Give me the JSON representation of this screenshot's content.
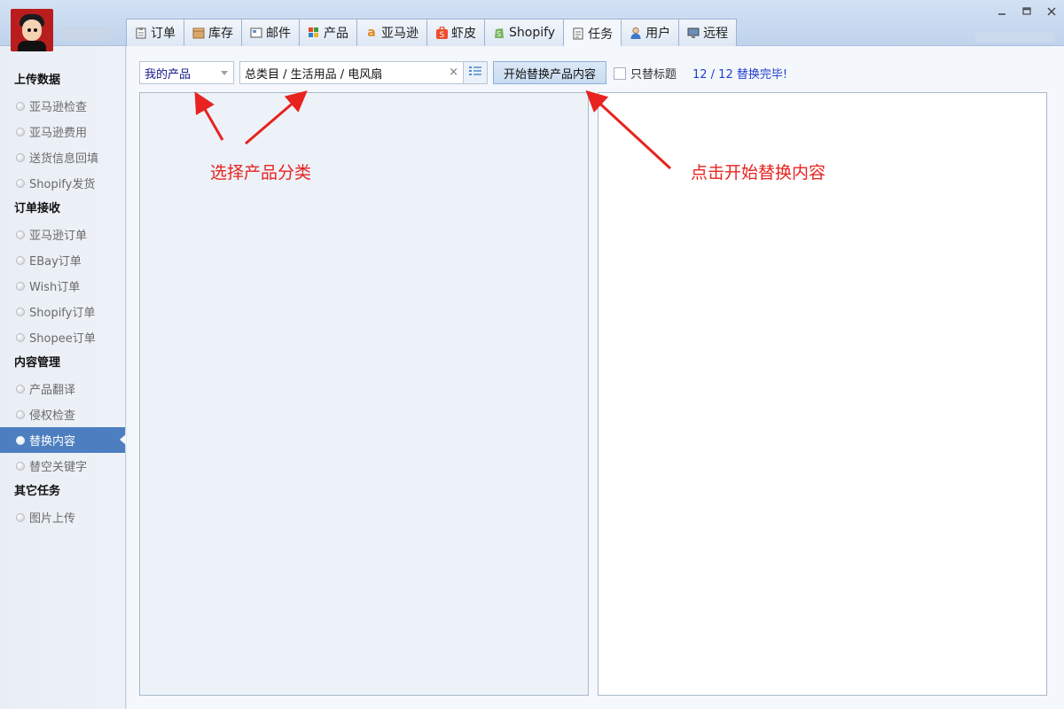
{
  "tabs": [
    {
      "label": "订单",
      "icon": "clipboard-icon"
    },
    {
      "label": "库存",
      "icon": "box-icon"
    },
    {
      "label": "邮件",
      "icon": "mail-icon"
    },
    {
      "label": "产品",
      "icon": "grid-icon"
    },
    {
      "label": "亚马逊",
      "icon": "amazon-icon"
    },
    {
      "label": "虾皮",
      "icon": "shopee-icon"
    },
    {
      "label": "Shopify",
      "icon": "shopify-icon"
    },
    {
      "label": "任务",
      "icon": "task-icon",
      "active": true
    },
    {
      "label": "用户",
      "icon": "user-icon"
    },
    {
      "label": "远程",
      "icon": "monitor-icon"
    }
  ],
  "sidebar": {
    "groups": [
      {
        "title": "上传数据",
        "items": [
          "亚马逊检查",
          "亚马逊费用",
          "送货信息回填",
          "Shopify发货"
        ]
      },
      {
        "title": "订单接收",
        "items": [
          "亚马逊订单",
          "EBay订单",
          "Wish订单",
          "Shopify订单",
          "Shopee订单"
        ]
      },
      {
        "title": "内容管理",
        "items": [
          "产品翻译",
          "侵权检查",
          "替换内容",
          "替空关键字"
        ]
      },
      {
        "title": "其它任务",
        "items": [
          "图片上传"
        ]
      }
    ],
    "active_item": "替换内容"
  },
  "toolbar": {
    "select_value": "我的产品",
    "category_path": "总类目 / 生活用品 / 电风扇",
    "clear_symbol": "×",
    "start_button": "开始替换产品内容",
    "checkbox_label": "只替标题",
    "checkbox_checked": false,
    "status": "12 / 12 替换完毕!"
  },
  "annotations": {
    "left": "选择产品分类",
    "right": "点击开始替换内容"
  },
  "colors": {
    "accent": "#4d7fc0",
    "annotation": "#e8231f",
    "status": "#1f3fd0"
  }
}
